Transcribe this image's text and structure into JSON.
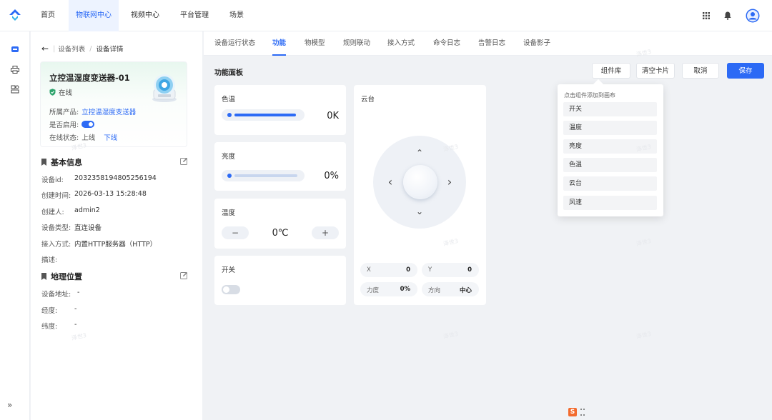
{
  "topnav": {
    "items": [
      "首页",
      "物联网中心",
      "视频中心",
      "平台管理",
      "场景"
    ],
    "active": 1,
    "icons": [
      "apps-grid-icon",
      "bell-icon",
      "user-avatar-icon"
    ]
  },
  "rail": {
    "icons": [
      "device-icon",
      "printer-icon",
      "group-icon"
    ],
    "collapse_label": "»"
  },
  "breadcrumb": {
    "back": "←",
    "items": [
      "设备列表",
      "设备详情"
    ],
    "sep": "/"
  },
  "device": {
    "name": "立控温湿度变送器-01",
    "status": "在线",
    "product_label": "所属产品:",
    "product_value": "立控温湿度变送器",
    "enabled_label": "是否启用:",
    "enabled": true,
    "online_label": "在线状态:",
    "online_value": "上线",
    "offline_link": "下线"
  },
  "basic_info": {
    "title": "基本信息",
    "rows": [
      {
        "k": "设备id:",
        "v": "2032358194805256194"
      },
      {
        "k": "创建时间:",
        "v": "2026-03-13 15:28:48"
      },
      {
        "k": "创建人:",
        "v": "admin2"
      },
      {
        "k": "设备类型:",
        "v": "直连设备"
      },
      {
        "k": "接入方式:",
        "v": "内置HTTP服务器（HTTP）"
      },
      {
        "k": "描述:",
        "v": ""
      }
    ]
  },
  "geo": {
    "title": "地理位置",
    "rows": [
      {
        "k": "设备地址:",
        "v": "-"
      },
      {
        "k": "经度:",
        "v": "-"
      },
      {
        "k": "纬度:",
        "v": "-"
      }
    ]
  },
  "tabs": [
    "设备运行状态",
    "功能",
    "物模型",
    "规则联动",
    "接入方式",
    "命令日志",
    "告警日志",
    "设备影子"
  ],
  "active_tab": 1,
  "panel": {
    "title": "功能面板",
    "buttons": {
      "library": "组件库",
      "clear": "清空卡片",
      "cancel": "取消",
      "save": "保存"
    },
    "color_temp": {
      "title": "色温",
      "value": "0K",
      "level": 0
    },
    "brightness": {
      "title": "亮度",
      "value": "0%",
      "level": 0
    },
    "temperature": {
      "title": "温度",
      "value": "0℃",
      "minus": "−",
      "plus": "+"
    },
    "switch": {
      "title": "开关",
      "on": false
    },
    "ptz": {
      "title": "云台",
      "arrows": {
        "up": "⌃",
        "down": "⌄",
        "left": "‹",
        "right": "›"
      },
      "x_label": "X",
      "x_value": "0",
      "y_label": "Y",
      "y_value": "0",
      "force_label": "力度",
      "force_value": "0%",
      "dir_label": "方向",
      "dir_value": "中心"
    }
  },
  "library": {
    "hint": "点击组件添加到画布",
    "items": [
      "开关",
      "温度",
      "亮度",
      "色温",
      "云台",
      "风速"
    ]
  },
  "watermark": "泽世3",
  "colors": {
    "accent": "#2c6af5",
    "online": "#2ca36b"
  }
}
